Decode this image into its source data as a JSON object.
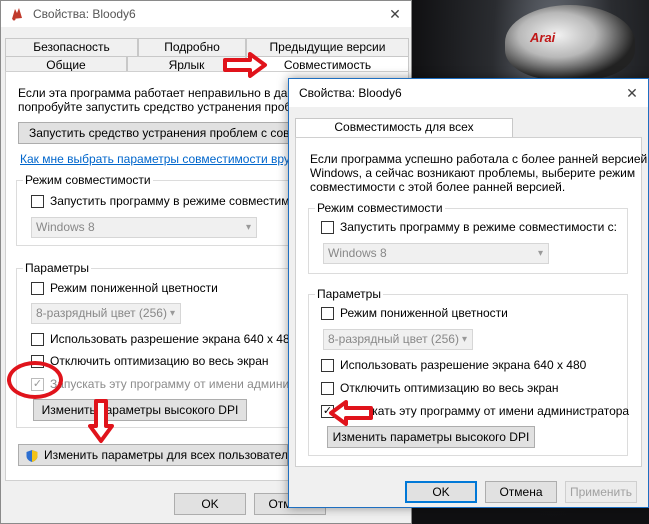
{
  "window1": {
    "title": "Свойства: Bloody6",
    "close_glyph": "✕",
    "tabs_top": [
      "Безопасность",
      "Подробно",
      "Предыдущие версии"
    ],
    "tabs_bottom": [
      "Общие",
      "Ярлык",
      "Совместимость"
    ],
    "intro_line1": "Если эта программа работает неправильно в данной",
    "intro_line2": "попробуйте запустить средство устранения проблем",
    "troubleshoot_button": "Запустить средство устранения проблем с совмес",
    "help_link": "Как мне выбрать параметры совместимости вручну",
    "compat_group_label": "Режим совместимости",
    "compat_checkbox": "Запустить программу в режиме совместимости",
    "compat_combo": "Windows 8",
    "params_group_label": "Параметры",
    "reduced_color": "Режим пониженной цветности",
    "color_combo": "8-разрядный цвет (256)",
    "res_640": "Использовать разрешение экрана 640 x 480",
    "disable_fullscreen": "Отключить оптимизацию во весь экран",
    "run_as_admin": "Запускать эту программу от имени администрат",
    "high_dpi_button": "Изменить параметры высокого DPI",
    "all_users_button": "Изменить параметры для всех пользователей",
    "ok_button": "OK",
    "cancel_button": "Отмена"
  },
  "window2": {
    "title": "Свойства: Bloody6",
    "close_glyph": "✕",
    "tab": "Совместимость для всех пользователей",
    "intro_line1": "Если программа успешно работала с более ранней версией",
    "intro_line2": "Windows, а сейчас возникают проблемы, выберите режим",
    "intro_line3": "совместимости с этой более ранней версией.",
    "compat_group_label": "Режим совместимости",
    "compat_checkbox": "Запустить программу в режиме совместимости с:",
    "compat_combo": "Windows 8",
    "params_group_label": "Параметры",
    "reduced_color": "Режим пониженной цветности",
    "color_combo": "8-разрядный цвет (256)",
    "res_640": "Использовать разрешение экрана 640 x 480",
    "disable_fullscreen": "Отключить оптимизацию во весь экран",
    "run_as_admin": "Запускать эту программу от имени администратора",
    "high_dpi_button": "Изменить параметры высокого DPI",
    "ok_button": "OK",
    "cancel_button": "Отмена",
    "apply_button": "Применить"
  },
  "wallpaper": {
    "brand_text": "Arai"
  },
  "colors": {
    "annotation_red": "#e0131b",
    "accent_blue": "#0078d7",
    "link_blue": "#0066cc"
  },
  "checkmark": "✓",
  "combo_arrow": "▾"
}
